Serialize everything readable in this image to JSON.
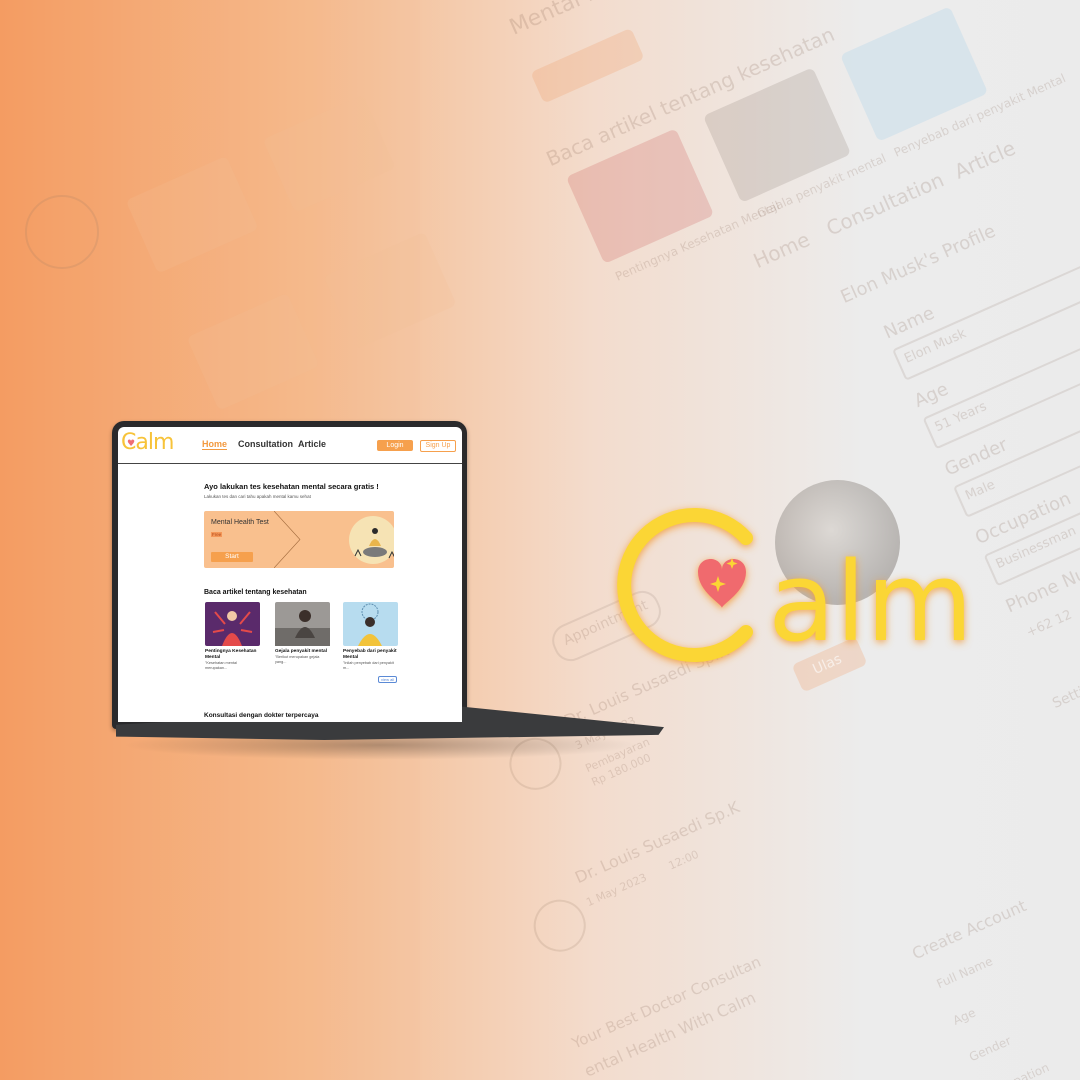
{
  "background": {
    "texts": [
      {
        "text": "Mental Health Test"
      },
      {
        "text": "Start"
      },
      {
        "text": "Baca artikel tentang kesehatan"
      },
      {
        "text": "Gejala penyakit mental"
      },
      {
        "text": "Penyebab dari penyakit Mental"
      },
      {
        "text": "Pentingnya Kesehatan Mental"
      },
      {
        "text": "Home"
      },
      {
        "text": "Consultation"
      },
      {
        "text": "Article"
      },
      {
        "text": "Elon Musk's Profile"
      },
      {
        "text": "Name"
      },
      {
        "text": "Elon Musk"
      },
      {
        "text": "Age"
      },
      {
        "text": "51 Years"
      },
      {
        "text": "Gender"
      },
      {
        "text": "Male"
      },
      {
        "text": "Occupation"
      },
      {
        "text": "Businessman"
      },
      {
        "text": "Phone Nu"
      },
      {
        "text": "+62 12"
      },
      {
        "text": "Appointment"
      },
      {
        "text": "Dr. Louis Susaedi Sp.K"
      },
      {
        "text": "3 May 2023"
      },
      {
        "text": "Pembayaran"
      },
      {
        "text": "Rp 180.000"
      },
      {
        "text": "Ulas"
      },
      {
        "text": "Dr. Louis Susaedi Sp.K"
      },
      {
        "text": "1 May 2023"
      },
      {
        "text": "12:00"
      },
      {
        "text": "Create Account"
      },
      {
        "text": "Full Name"
      },
      {
        "text": "Age"
      },
      {
        "text": "Gender"
      },
      {
        "text": "Occupation"
      },
      {
        "text": "Your Best Doctor Consultan"
      },
      {
        "text": "ental Health With Calm"
      },
      {
        "text": "Setti"
      }
    ]
  },
  "laptop_screen": {
    "nav": {
      "logo": "Calm",
      "home": "Home",
      "consultation": "Consultation",
      "article": "Article",
      "login": "Login",
      "signup": "Sign Up"
    },
    "hero": {
      "title": "Ayo lakukan tes kesehatan mental secara gratis !",
      "subtitle": "Lakukan tes dan cari tahu apakah mental kamu sehat"
    },
    "test_card": {
      "title": "Mental Health Test",
      "badge": "Free",
      "button": "Start"
    },
    "articles_section": {
      "title": "Baca artikel tentang kesehatan",
      "items": [
        {
          "title": "Pentingnya Kesehatan Mental",
          "desc": "\"Kesehatan mental merupakan...",
          "color": "#5a2a6b"
        },
        {
          "title": "Gejala penyakit mental",
          "desc": "\"Berikut merupakan gejala yang...",
          "color": "#9c9996"
        },
        {
          "title": "Penyebab dari penyakit Mental",
          "desc": "\"Inilah penyebab dari penyakit m...",
          "color": "#b7dcef"
        }
      ],
      "view_all": "view all"
    },
    "bottom_section_title": "Konsultasi dengan dokter terpercaya"
  },
  "brand": {
    "logo_text": "Calm",
    "logo_color": "#fbd634",
    "heart_color": "#f06b6e",
    "accent": "#f6a04d"
  }
}
